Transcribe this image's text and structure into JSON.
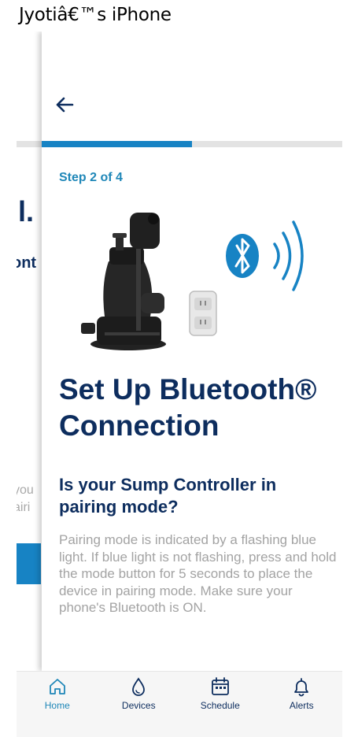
{
  "device": {
    "title": "Jyotiâ€™s iPhone"
  },
  "background_screen": {
    "heading_fragment": "ll.",
    "sub_fragment": "ont",
    "body_fragment_1": "you",
    "body_fragment_2": "airi"
  },
  "header": {
    "back_icon": "arrow-left-icon"
  },
  "progress": {
    "step": 2,
    "total": 4,
    "fraction": 0.5
  },
  "step_label": "Step 2 of 4",
  "illustration": {
    "items": [
      "sump-pump-image",
      "outlet-controller-image",
      "bluetooth-icon",
      "signal-waves-icon"
    ]
  },
  "title": "Set Up Bluetooth®\nConnection",
  "question": "Is your Sump Controller in pairing mode?",
  "description": "Pairing mode is indicated by a flashing blue light. If blue light is not flashing, press and hold the mode button for 5 seconds to place the device in pairing mode. Make sure your phone's Bluetooth is ON.",
  "tabs": [
    {
      "label": "Home",
      "icon": "home-icon",
      "active": true
    },
    {
      "label": "Devices",
      "icon": "droplet-icon",
      "active": false
    },
    {
      "label": "Schedule",
      "icon": "calendar-icon",
      "active": false
    },
    {
      "label": "Alerts",
      "icon": "bell-icon",
      "active": false
    }
  ],
  "colors": {
    "accent": "#1783c4",
    "step_text": "#1f87b8",
    "heading": "#0d2d5e",
    "body_text": "#a3a3a3"
  }
}
